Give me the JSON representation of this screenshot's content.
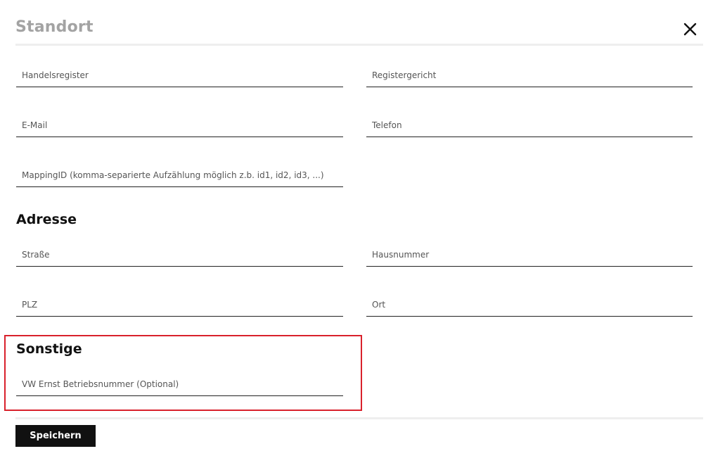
{
  "dialog": {
    "title": "Standort",
    "close_icon": "close-icon"
  },
  "general": {
    "handelsregister": {
      "placeholder": "Handelsregister",
      "value": ""
    },
    "registergericht": {
      "placeholder": "Registergericht",
      "value": ""
    },
    "email": {
      "placeholder": "E-Mail",
      "value": ""
    },
    "telefon": {
      "placeholder": "Telefon",
      "value": ""
    },
    "mapping_id": {
      "placeholder": "MappingID (komma-separierte Aufzählung möglich z.b. id1, id2, id3, ...)",
      "value": ""
    }
  },
  "address": {
    "heading": "Adresse",
    "strasse": {
      "placeholder": "Straße",
      "value": ""
    },
    "hausnummer": {
      "placeholder": "Hausnummer",
      "value": ""
    },
    "plz": {
      "placeholder": "PLZ",
      "value": ""
    },
    "ort": {
      "placeholder": "Ort",
      "value": ""
    }
  },
  "other": {
    "heading": "Sonstige",
    "vw_betriebsnummer": {
      "placeholder": "VW Ernst Betriebsnummer (Optional)",
      "value": ""
    }
  },
  "footer": {
    "save_label": "Speichern"
  },
  "colors": {
    "highlight": "#d9212c",
    "button_bg": "#111111",
    "title": "#a3a3a3"
  }
}
